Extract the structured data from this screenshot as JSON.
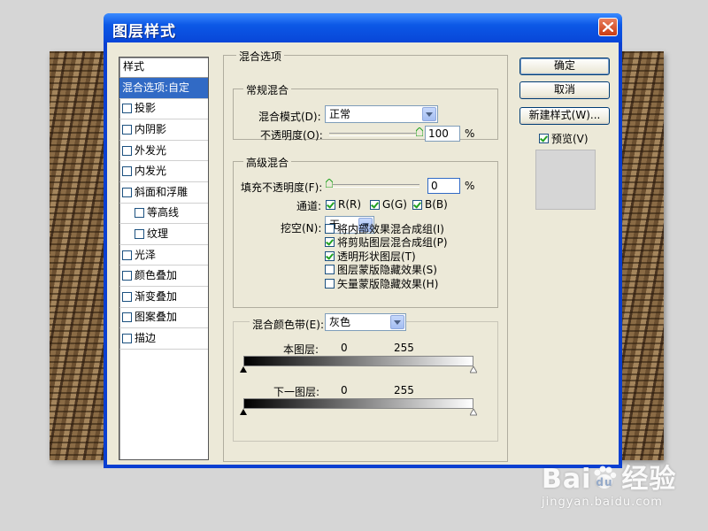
{
  "dialog": {
    "title": "图层样式",
    "close_icon": "close-icon",
    "colors": {
      "titlebar": "#0846d8",
      "client": "#ece9d8",
      "selection": "#316ac5",
      "close": "#c93b12"
    }
  },
  "styles_panel": {
    "header": "样式",
    "items": [
      {
        "label": "混合选项:自定",
        "checkbox": false,
        "active": true,
        "sub": false
      },
      {
        "label": "投影",
        "checkbox": true,
        "checked": false,
        "sub": false
      },
      {
        "label": "内阴影",
        "checkbox": true,
        "checked": false,
        "sub": false
      },
      {
        "label": "外发光",
        "checkbox": true,
        "checked": false,
        "sub": false
      },
      {
        "label": "内发光",
        "checkbox": true,
        "checked": false,
        "sub": false
      },
      {
        "label": "斜面和浮雕",
        "checkbox": true,
        "checked": false,
        "sub": false
      },
      {
        "label": "等高线",
        "checkbox": true,
        "checked": false,
        "sub": true
      },
      {
        "label": "纹理",
        "checkbox": true,
        "checked": false,
        "sub": true
      },
      {
        "label": "光泽",
        "checkbox": true,
        "checked": false,
        "sub": false
      },
      {
        "label": "颜色叠加",
        "checkbox": true,
        "checked": false,
        "sub": false
      },
      {
        "label": "渐变叠加",
        "checkbox": true,
        "checked": false,
        "sub": false
      },
      {
        "label": "图案叠加",
        "checkbox": true,
        "checked": false,
        "sub": false
      },
      {
        "label": "描边",
        "checkbox": true,
        "checked": false,
        "sub": false
      }
    ]
  },
  "blend_options": {
    "legend": "混合选项",
    "general": {
      "legend": "常规混合",
      "mode_label": "混合模式(D):",
      "mode_value": "正常",
      "opacity_label": "不透明度(O):",
      "opacity_value": "100",
      "opacity_unit": "%",
      "opacity_level": 1.0
    },
    "advanced": {
      "legend": "高级混合",
      "fill_label": "填充不透明度(F):",
      "fill_value": "0",
      "fill_unit": "%",
      "fill_level": 0.0,
      "channels_label": "通道:",
      "channels": [
        {
          "label": "R(R)",
          "checked": true
        },
        {
          "label": "G(G)",
          "checked": true
        },
        {
          "label": "B(B)",
          "checked": true
        }
      ],
      "knockout_label": "挖空(N):",
      "knockout_value": "无",
      "options": [
        {
          "label": "将内部效果混合成组(I)",
          "checked": false
        },
        {
          "label": "将剪贴图层混合成组(P)",
          "checked": true
        },
        {
          "label": "透明形状图层(T)",
          "checked": true
        },
        {
          "label": "图层蒙版隐藏效果(S)",
          "checked": false
        },
        {
          "label": "矢量蒙版隐藏效果(H)",
          "checked": false
        }
      ]
    },
    "blend_if": {
      "label": "混合颜色带(E):",
      "value": "灰色",
      "this_layer": {
        "label": "本图层:",
        "min": "0",
        "max": "255"
      },
      "underlying": {
        "label": "下一图层:",
        "min": "0",
        "max": "255"
      }
    }
  },
  "buttons": {
    "ok": "确定",
    "cancel": "取消",
    "new_style": "新建样式(W)...",
    "preview_label": "预览(V)",
    "preview_checked": true
  },
  "watermark": {
    "brand": "Bai",
    "brand_suffix": "经验",
    "url": "jingyan.baidu.com"
  }
}
